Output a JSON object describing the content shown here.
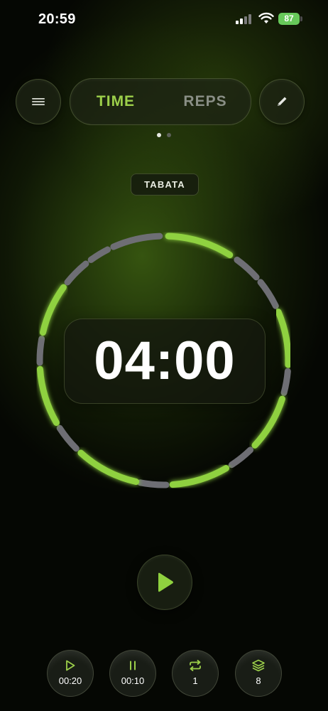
{
  "status_bar": {
    "time": "20:59",
    "battery": "87"
  },
  "header": {
    "menu_icon": "menu-icon",
    "edit_icon": "pencil-icon",
    "tabs": [
      {
        "label": "TIME",
        "active": true
      },
      {
        "label": "REPS",
        "active": false
      }
    ],
    "page_indicator": {
      "count": 2,
      "current": 1
    }
  },
  "workout": {
    "type": "TABATA"
  },
  "timer": {
    "display": "04:00"
  },
  "controls": {
    "play_icon": "play-icon"
  },
  "stats": [
    {
      "icon": "play-icon",
      "value": "00:20"
    },
    {
      "icon": "pause-icon",
      "value": "00:10"
    },
    {
      "icon": "repeat-icon",
      "value": "1"
    },
    {
      "icon": "layers-icon",
      "value": "8"
    }
  ],
  "colors": {
    "accent": "#9ccf4a",
    "ring_active": "#8fd13f",
    "ring_inactive": "#6e6e74"
  }
}
